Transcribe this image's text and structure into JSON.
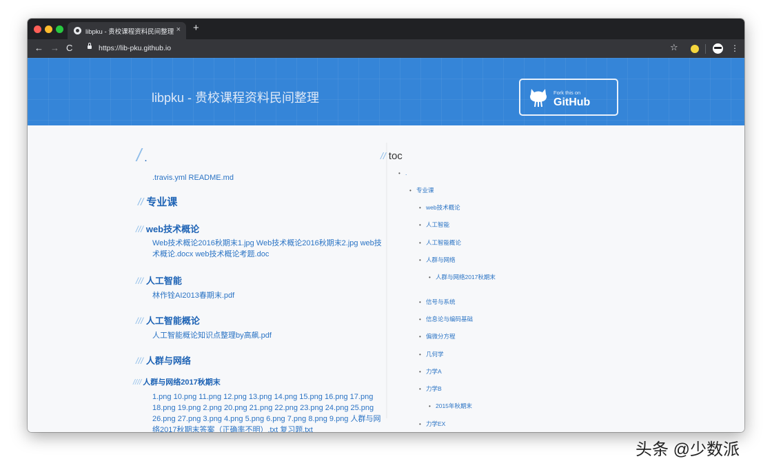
{
  "browser": {
    "tab_title": "libpku - 贵校课程资料民间整理",
    "tab_close": "×",
    "new_tab": "+",
    "url": "https://lib-pku.github.io",
    "back": "←",
    "forward": "→",
    "reload": "C",
    "star": "☆",
    "menu": "⋮"
  },
  "header": {
    "title": "libpku - 贵校课程资料民间整理",
    "fork_small": "Fork this on",
    "fork_big": "GitHub"
  },
  "content": {
    "root_heading": ".",
    "root_files": ".travis.yml README.md",
    "section_major": "专业课",
    "web_heading": "web技术概论",
    "web_files": "Web技术概论2016秋期末1.jpg Web技术概论2016秋期末2.jpg web技术概论.docx web技术概论考题.doc",
    "ai_heading": "人工智能",
    "ai_files": "林作铨AI2013春期末.pdf",
    "aigen_heading": "人工智能概论",
    "aigen_files": "人工智能概论知识点整理by高飙.pdf",
    "net_heading": "人群与网络",
    "net_sub_heading": "人群与网络2017秋期末",
    "net_sub_files": "1.png 10.png 11.png 12.png 13.png 14.png 15.png 16.png 17.png 18.png 19.png 2.png 20.png 21.png 22.png 23.png 24.png 25.png 26.png 27.png 3.png 4.png 5.png 6.png 7.png 8.png 9.png 人群与网络2017秋期末答案（正确率不明）.txt 复习题.txt"
  },
  "toc": {
    "title": "toc",
    "items": [
      {
        "label": "."
      },
      {
        "label": "专业课"
      },
      {
        "label": "web技术概论"
      },
      {
        "label": "人工智能"
      },
      {
        "label": "人工智能概论"
      },
      {
        "label": "人群与网络"
      },
      {
        "label": "人群与网络2017秋期末"
      },
      {
        "label": "信号与系统"
      },
      {
        "label": "信息论与编码基础"
      },
      {
        "label": "偏微分方程"
      },
      {
        "label": "几何学"
      },
      {
        "label": "力学A"
      },
      {
        "label": "力学B"
      },
      {
        "label": "2015年秋期末"
      },
      {
        "label": "力学EX"
      }
    ]
  },
  "watermark": "头条 @少数派"
}
